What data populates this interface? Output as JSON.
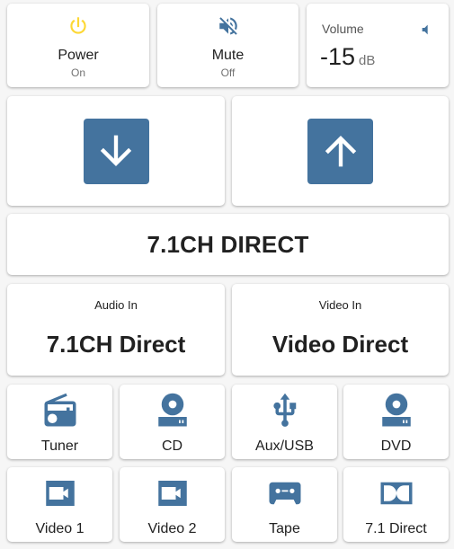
{
  "power": {
    "name": "Power",
    "state": "On",
    "icon": "power-icon",
    "icon_color": "#fdd835"
  },
  "mute": {
    "name": "Mute",
    "state": "Off",
    "icon": "volume-off-icon",
    "icon_color": "#44739e"
  },
  "volume": {
    "label": "Volume",
    "value": "-15",
    "unit": "dB",
    "icon": "volume-low-icon"
  },
  "arrows": {
    "down_icon": "arrow-down-icon",
    "up_icon": "arrow-up-icon",
    "accent": "#44739e"
  },
  "mode": {
    "text": "7.1CH DIRECT"
  },
  "audio_in": {
    "label": "Audio In",
    "value": "7.1CH Direct"
  },
  "video_in": {
    "label": "Video In",
    "value": "Video Direct"
  },
  "sources": [
    {
      "label": "Tuner",
      "icon": "radio-icon"
    },
    {
      "label": "CD",
      "icon": "cd-player-icon"
    },
    {
      "label": "Aux/USB",
      "icon": "usb-icon"
    },
    {
      "label": "DVD",
      "icon": "disc-player-icon"
    },
    {
      "label": "Video 1",
      "icon": "video-icon"
    },
    {
      "label": "Video 2",
      "icon": "video-icon"
    },
    {
      "label": "Tape",
      "icon": "cassette-icon"
    },
    {
      "label": "7.1 Direct",
      "icon": "dolby-icon"
    }
  ]
}
